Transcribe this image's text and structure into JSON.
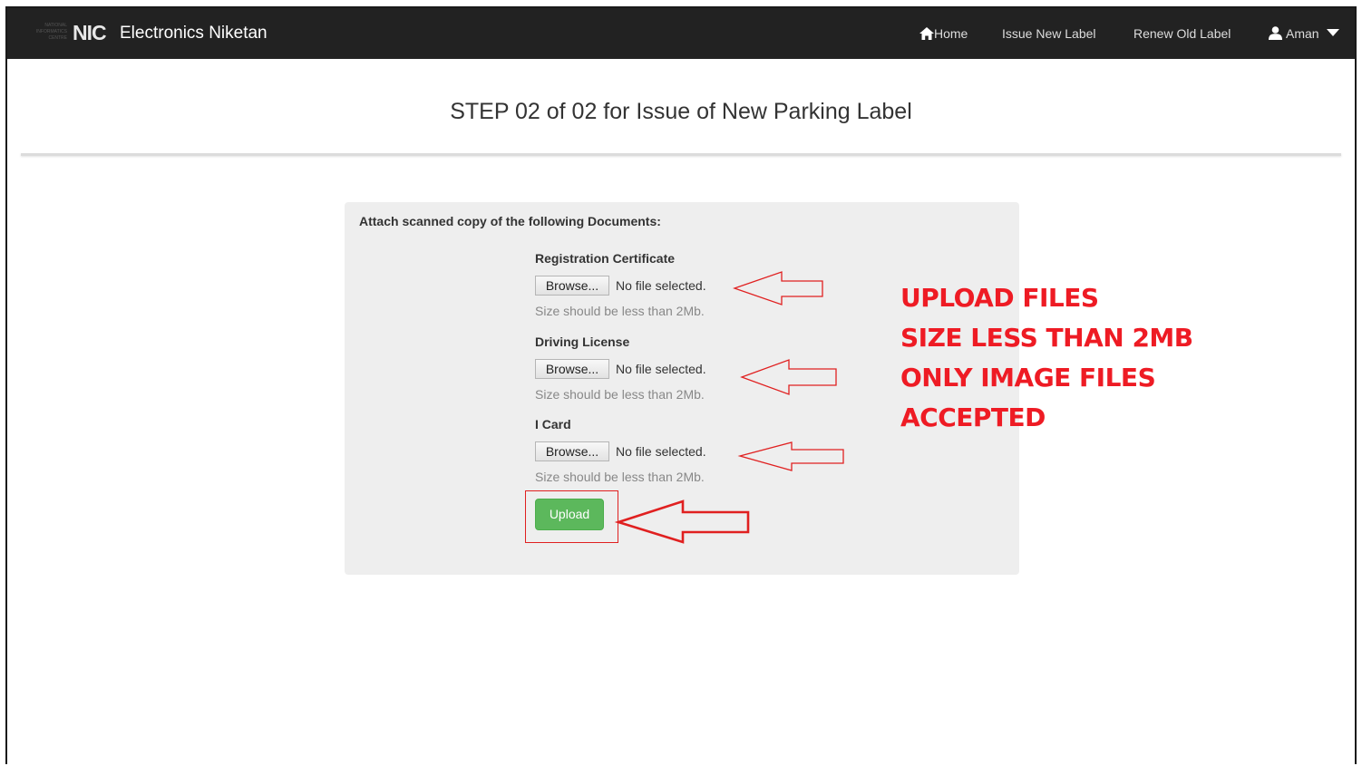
{
  "brand": {
    "logo_text": "NIC",
    "logo_small_lines": [
      "NATIONAL",
      "INFORMATICS",
      "CENTRE"
    ],
    "name": "Electronics Niketan"
  },
  "nav": {
    "home": "Home",
    "issue_new_label": "Issue New Label",
    "renew_old_label": "Renew Old Label",
    "user": "Aman"
  },
  "page": {
    "title": "STEP 02 of 02 for Issue of New Parking Label"
  },
  "form": {
    "heading": "Attach scanned copy of the following Documents:",
    "fields": [
      {
        "label": "Registration Certificate",
        "browse": "Browse...",
        "status": "No file selected.",
        "help": "Size should be less than 2Mb."
      },
      {
        "label": "Driving License",
        "browse": "Browse...",
        "status": "No file selected.",
        "help": "Size should be less than 2Mb."
      },
      {
        "label": "I Card",
        "browse": "Browse...",
        "status": "No file selected.",
        "help": "Size should be less than 2Mb."
      }
    ],
    "upload_label": "Upload"
  },
  "annotation": {
    "lines": [
      "UPLOAD FILES",
      "SIZE LESS THAN 2MB",
      "ONLY IMAGE FILES",
      "ACCEPTED"
    ],
    "color": "#ee1b24"
  },
  "colors": {
    "navbar": "#222222",
    "upload_button": "#5cb85c",
    "annotation": "#ee1b24"
  }
}
